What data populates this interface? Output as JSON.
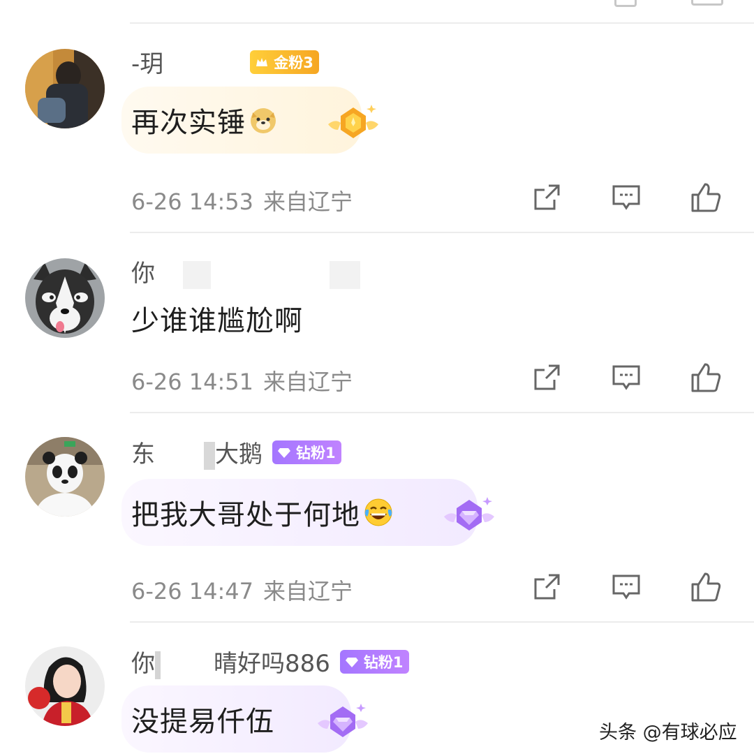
{
  "comments": [
    {
      "username": "-玥",
      "username_tail": "",
      "badge_type": "gold",
      "badge_label": "金粉3",
      "text": "再次实锤",
      "emoji": "doge-emoji",
      "time": "6-26 14:53",
      "location": "来自辽宁"
    },
    {
      "username": "你",
      "username_tail": "",
      "badge_type": "",
      "badge_label": "",
      "text": "少谁谁尴尬啊",
      "emoji": "",
      "time": "6-26 14:51",
      "location": "来自辽宁"
    },
    {
      "username": "东",
      "username_tail": "大鹅",
      "badge_type": "diamond",
      "badge_label": "钻粉1",
      "text": "把我大哥处于何地",
      "emoji": "laugh-cry-emoji",
      "time": "6-26 14:47",
      "location": "来自辽宁"
    },
    {
      "username": "你",
      "username_tail": "晴好吗886",
      "badge_type": "diamond",
      "badge_label": "钻粉1",
      "text": "没提易仟伍",
      "emoji": "",
      "time": "",
      "location": ""
    }
  ],
  "icons": {
    "repost": "repost-icon",
    "comment": "comment-icon",
    "like": "like-icon"
  },
  "colors": {
    "gold_badge": "#f6a623",
    "diamond_badge": "#b07cff",
    "meta_text": "#8a8a8a",
    "divider": "#ececec"
  },
  "watermark": "头条 @有球必应"
}
